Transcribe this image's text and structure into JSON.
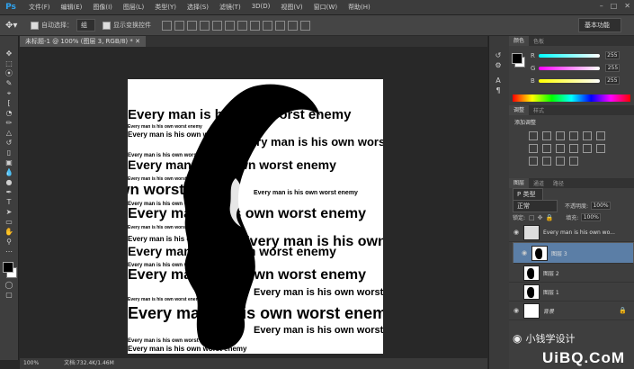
{
  "menubar": {
    "logo": "Ps",
    "items": [
      "文件(F)",
      "编辑(E)",
      "图像(I)",
      "图层(L)",
      "类型(Y)",
      "选择(S)",
      "滤镜(T)",
      "3D(D)",
      "视图(V)",
      "窗口(W)",
      "帮助(H)"
    ]
  },
  "optbar": {
    "auto_select_label": "自动选择：",
    "auto_select_value": "组",
    "show_transform_label": "显示变换控件",
    "workspace": "基本功能"
  },
  "document": {
    "tab": "未标题-1 @ 100% (图层 3, RGB/8) *",
    "status_zoom": "100%",
    "status_doc": "文档:732.4K/1.46M"
  },
  "canvas_text": {
    "big": "Every man is his own worst enemy",
    "small": "Every man is his own worst enemy"
  },
  "color_panel": {
    "tabs": [
      "颜色",
      "色板"
    ],
    "r_label": "R",
    "g_label": "G",
    "b_label": "B",
    "r": "255",
    "g": "255",
    "b": "255"
  },
  "adjust_panel": {
    "tabs": [
      "调整",
      "样式"
    ],
    "title": "添加调整"
  },
  "layers_panel": {
    "tabs": [
      "图层",
      "通道",
      "路径"
    ],
    "filter": "P 类型",
    "blend": "正常",
    "opacity_label": "不透明度:",
    "opacity": "100%",
    "lock_label": "锁定:",
    "fill_label": "填充:",
    "fill": "100%",
    "layers": [
      {
        "name": "Every man is his own wo..."
      },
      {
        "name": "图层 3"
      },
      {
        "name": "图层 2"
      },
      {
        "name": "图层 1"
      },
      {
        "name": "背景"
      }
    ]
  },
  "watermark": {
    "name": "小钱学设计",
    "site": "UiBQ.CoM"
  },
  "colors": {
    "accent": "#2fa3ef",
    "selected_layer": "#5b7ea6"
  }
}
